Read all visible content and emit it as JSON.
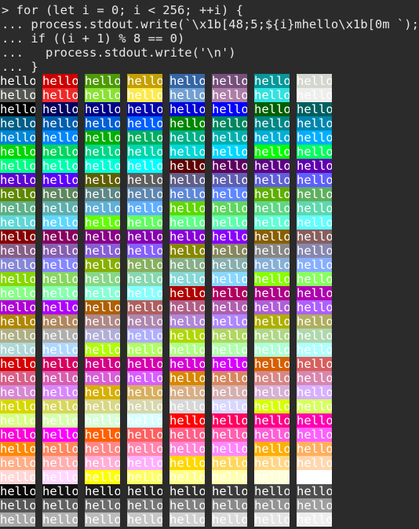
{
  "terminal": {
    "code_lines": [
      "> for (let i = 0; i < 256; ++i) {",
      "... process.stdout.write(`\\x1b[48;5;${i}mhello\\x1b[0m `);",
      "... if ((i + 1) % 8 == 0)",
      "...   process.stdout.write('\\n')",
      "... }"
    ],
    "cell_text": "hello",
    "palette_color_count": 256,
    "colors_per_row": 8,
    "text_color": "#ffffff",
    "background": "#2b2b2b",
    "base16": [
      "#2b2b2b",
      "#cc0000",
      "#4e9a06",
      "#c4a000",
      "#3465a4",
      "#75507b",
      "#06989a",
      "#d3d7cf",
      "#555753",
      "#ef2929",
      "#8ae234",
      "#fce94f",
      "#729fcf",
      "#ad7fa8",
      "#34e2e2",
      "#eeeeec"
    ],
    "cube_levels": [
      0,
      95,
      135,
      175,
      215,
      255
    ]
  }
}
